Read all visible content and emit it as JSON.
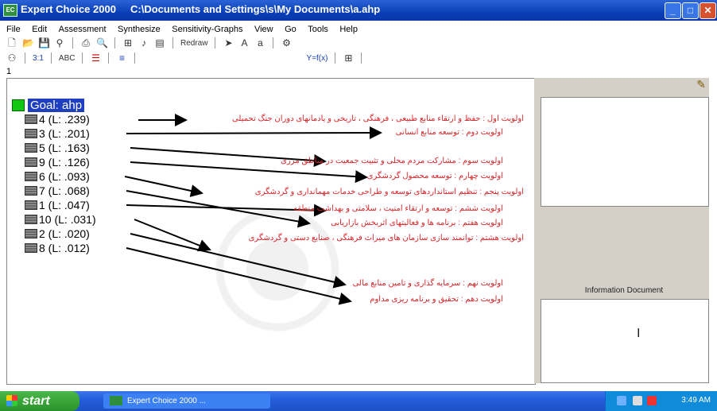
{
  "window": {
    "app_icon_text": "EC",
    "title": "Expert Choice 2000     C:\\Documents and Settings\\s\\My Documents\\a.ahp",
    "minimize_symbol": "_",
    "maximize_symbol": "□",
    "close_symbol": "✕"
  },
  "menu": {
    "items": [
      "File",
      "Edit",
      "Assessment",
      "Synthesize",
      "Sensitivity-Graphs",
      "View",
      "Go",
      "Tools",
      "Help"
    ]
  },
  "toolbar2": {
    "redraw_label": "Redraw"
  },
  "toolbar3": {
    "ratio_label": "3:1",
    "abc_label": "ABC",
    "formula_label": "Y=f(x)"
  },
  "row_number": "1",
  "tree": {
    "goal_label": "Goal: ahp",
    "nodes": [
      "4 (L: .239)",
      "3 (L: .201)",
      "5 (L: .163)",
      "9 (L: .126)",
      "6 (L: .093)",
      "7 (L: .068)",
      "1 (L: .047)",
      "10 (L: .031)",
      "2 (L: .020)",
      "8 (L: .012)"
    ]
  },
  "annotations": [
    "اولویت اول : حفظ و ارتقاء منابع طبیعی ، فرهنگی ، تاریخی و یادمانهای دوران جنگ تحمیلی",
    "اولویت دوم : توسعه منابع انسانی",
    "اولویت سوم : مشارکت مردم محلی و تثبیت جمعیت در مناطق مرزی",
    "اولویت چهارم : توسعه محصول گردشگری",
    "اولویت پنجم : تنظیم استانداردهای توسعه و طراحی خدمات مهمانداری و گردشگری",
    "اولویت ششم : توسعه و ارتقاء امنیت ، سلامتی و بهداشت منطقه",
    "اولویت هفتم : برنامه ها و فعالیتهای اثربخش بازاریابی",
    "اولویت هشتم : توانمند سازی سازمان های میراث فرهنگی ، صنایع دستی و گردشگری",
    "اولویت نهم : سرمایه گذاری و تامین منابع مالی",
    "اولویت دهم : تحقیق و برنامه ریزی مداوم"
  ],
  "right_panel": {
    "info_label": "Information Document",
    "cursor_glyph": "I"
  },
  "taskbar": {
    "start_label": "start",
    "task_label": "Expert Choice 2000 ...",
    "clock": "3:49 AM"
  },
  "colors": {
    "title_blue": "#0a3fb8",
    "goal_highlight": "#1e3fbf",
    "annotation_red": "#d7262a",
    "goal_green": "#12c812"
  }
}
